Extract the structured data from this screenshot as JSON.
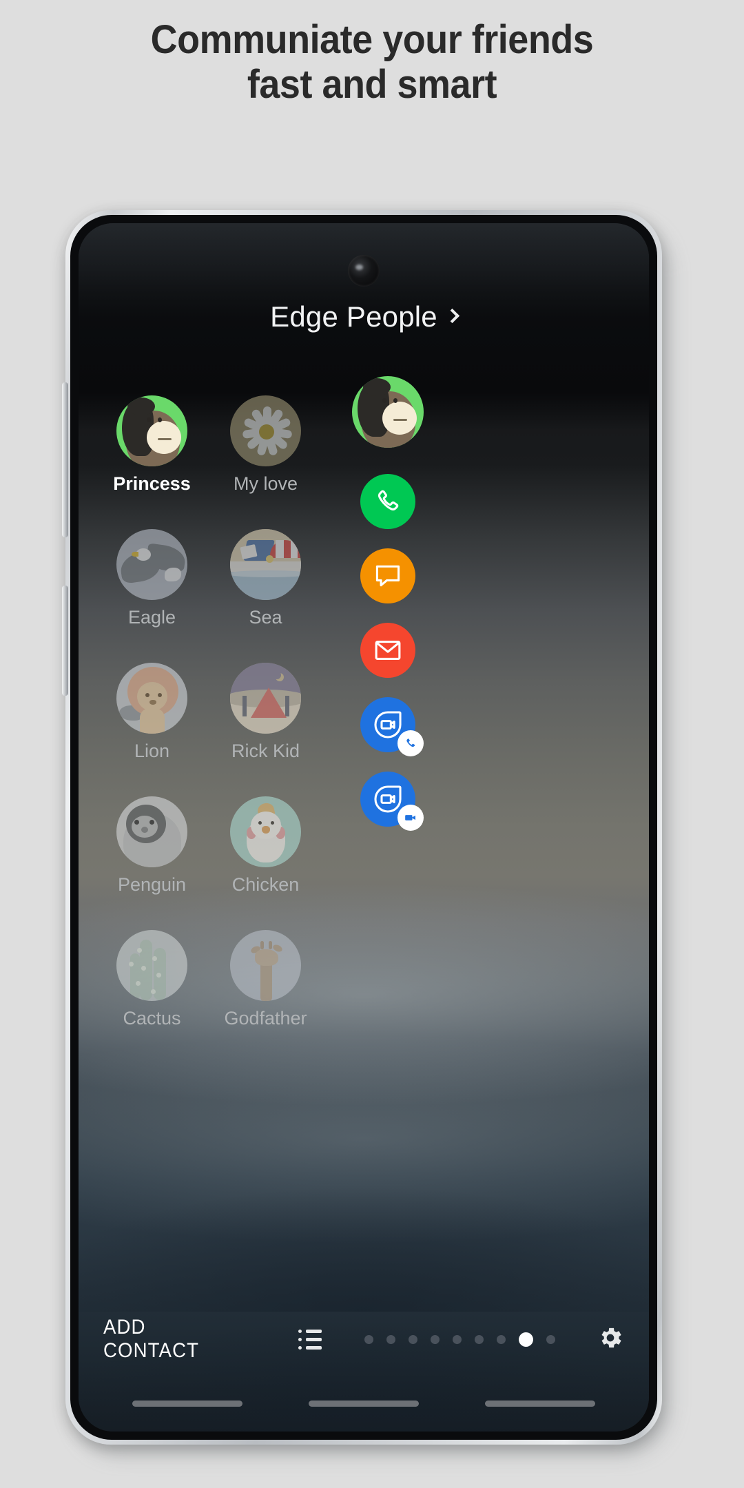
{
  "headline": {
    "line1": "Communiate your friends",
    "line2": "fast and smart"
  },
  "phone": {
    "panel_title": "Edge People",
    "chevron_icon": "chevron-right-icon",
    "camera_icon": "front-camera-punch-hole"
  },
  "contacts": [
    {
      "name": "Princess",
      "avatar": "gorilla-avatar",
      "selected": true,
      "accent": "#6ad96a"
    },
    {
      "name": "My love",
      "avatar": "daisy-avatar",
      "selected": false,
      "accent": "#9b9373"
    },
    {
      "name": "Eagle",
      "avatar": "eagle-avatar",
      "selected": false,
      "accent": "#b6bcc6"
    },
    {
      "name": "Sea",
      "avatar": "beach-avatar",
      "selected": false,
      "accent": "#d8cdb2"
    },
    {
      "name": "Lion",
      "avatar": "lion-avatar",
      "selected": false,
      "accent": "#cfd3d8"
    },
    {
      "name": "Rick Kid",
      "avatar": "tent-avatar",
      "selected": false,
      "accent": "#cfc7bb"
    },
    {
      "name": "Penguin",
      "avatar": "penguin-avatar",
      "selected": false,
      "accent": "#d3d5d7"
    },
    {
      "name": "Chicken",
      "avatar": "chicken-avatar",
      "selected": false,
      "accent": "#a9d6cd"
    },
    {
      "name": "Cactus",
      "avatar": "cactus-avatar",
      "selected": false,
      "accent": "#c9cfcf"
    },
    {
      "name": "Godfather",
      "avatar": "giraffe-avatar",
      "selected": false,
      "accent": "#b6bcc4"
    }
  ],
  "actions": {
    "selected_contact_avatar": "gorilla-avatar",
    "items": [
      {
        "icon": "phone-call-icon",
        "label": "Call",
        "color": "#00c853",
        "badge": null
      },
      {
        "icon": "message-bubble-icon",
        "label": "Message",
        "color": "#f59100",
        "badge": null
      },
      {
        "icon": "email-envelope-icon",
        "label": "Email",
        "color": "#f5462e",
        "badge": null
      },
      {
        "icon": "duo-icon",
        "label": "Duo audio",
        "color": "#1f72e0",
        "badge": "phone-badge-icon"
      },
      {
        "icon": "duo-icon",
        "label": "Duo video",
        "color": "#1f72e0",
        "badge": "video-badge-icon"
      }
    ]
  },
  "bottom_bar": {
    "add_contact_label": "ADD CONTACT",
    "list_icon": "list-view-icon",
    "settings_icon": "gear-icon",
    "pager": {
      "total": 9,
      "active_index": 7
    }
  },
  "nav_bar": {
    "pills": [
      "recents-pill",
      "home-pill",
      "back-pill"
    ]
  },
  "colors": {
    "page_background": "#dedede",
    "headline_text": "#2a2a2a",
    "selected_name": "#ffffff",
    "dim_name": "#b1b4b6"
  }
}
